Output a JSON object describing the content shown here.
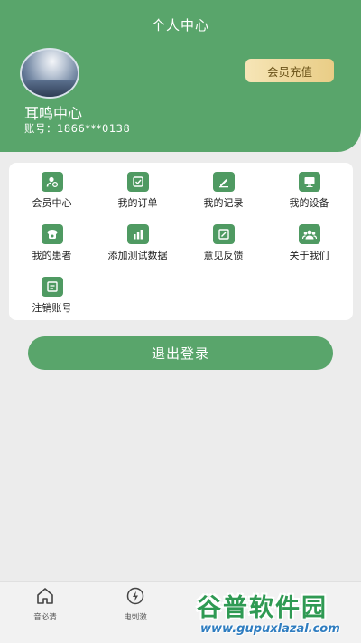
{
  "header": {
    "title": "个人中心",
    "nickname": "耳鸣中心",
    "account_label": "账号：",
    "account_value": "1866***0138",
    "vip_button": "会员充值"
  },
  "menu": {
    "items": [
      {
        "label": "会员中心",
        "icon": "vip-user-icon"
      },
      {
        "label": "我的订单",
        "icon": "order-icon"
      },
      {
        "label": "我的记录",
        "icon": "record-pencil-icon"
      },
      {
        "label": "我的设备",
        "icon": "device-monitor-icon"
      },
      {
        "label": "我的患者",
        "icon": "patient-phone-icon"
      },
      {
        "label": "添加测试数据",
        "icon": "bar-chart-icon"
      },
      {
        "label": "意见反馈",
        "icon": "feedback-icon"
      },
      {
        "label": "关于我们",
        "icon": "group-icon"
      },
      {
        "label": "注销账号",
        "icon": "cancel-account-icon"
      }
    ]
  },
  "logout_button": "退出登录",
  "tabbar": {
    "tabs": [
      {
        "label": "音必清",
        "icon": "home-icon"
      },
      {
        "label": "电刺激",
        "icon": "lightning-icon"
      }
    ]
  },
  "watermark": {
    "text": "谷普软件园",
    "url": "www.gupuxlazal.com"
  },
  "colors": {
    "primary": "#59a56b",
    "icon_green": "#4f9a62",
    "vip_gold": "#ecd394",
    "background": "#ececec"
  }
}
